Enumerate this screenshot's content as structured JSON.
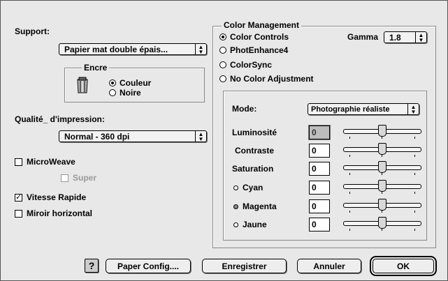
{
  "left": {
    "support_label": "Support:",
    "support_value": "Papier mat double épais...",
    "encre_title": "Encre",
    "encre_options": [
      "Couleur",
      "Noire"
    ],
    "quality_label": "Qualité_ d'impression:",
    "quality_value": "Normal - 360 dpi",
    "microweave": "MicroWeave",
    "super": "Super",
    "vitesse": "Vitesse Rapide",
    "miroir": "Miroir horizontal"
  },
  "color_mgmt": {
    "title": "Color Management",
    "options": [
      "Color Controls",
      "PhotEnhance4",
      "ColorSync",
      "No Color Adjustment"
    ],
    "gamma_label": "Gamma",
    "gamma_value": "1.8",
    "mode_label": "Mode:",
    "mode_value": "Photographie réaliste",
    "rows": [
      {
        "label": "Luminosité",
        "value": "0"
      },
      {
        "label": "Contraste",
        "value": "0"
      },
      {
        "label": "Saturation",
        "value": "0"
      },
      {
        "label": "Cyan",
        "value": "0"
      },
      {
        "label": "Magenta",
        "value": "0"
      },
      {
        "label": "Jaune",
        "value": "0"
      }
    ]
  },
  "buttons": {
    "help": "?",
    "paper_config": "Paper Config....",
    "save": "Enregistrer",
    "cancel": "Annuler",
    "ok": "OK"
  }
}
